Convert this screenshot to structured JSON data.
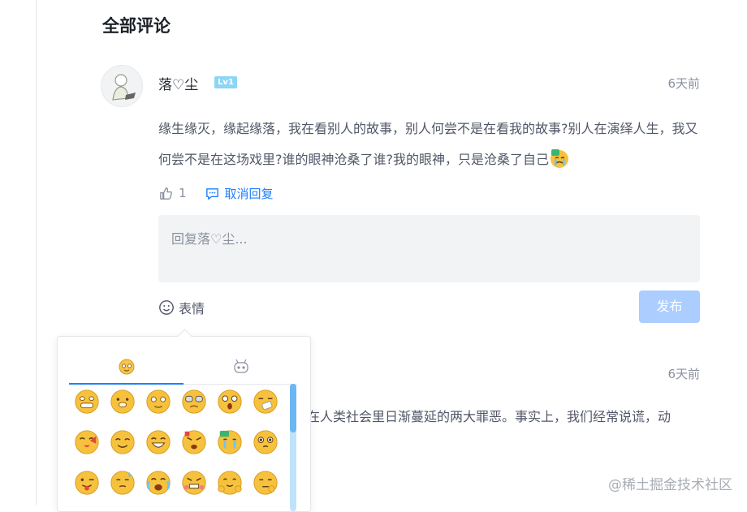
{
  "section": {
    "title": "全部评论"
  },
  "comment1": {
    "username": "落♡尘",
    "level": "Lv1",
    "time": "6天前",
    "text": "缘生缘灭，缘起缘落，我在看别人的故事，别人何尝不是在看我的故事?别人在演绎人生，我又何尝不是在这场戏里?谁的眼神沧桑了谁?我的眼神，只是沧桑了自己",
    "likes": "1",
    "cancel_reply_label": "取消回复",
    "reply_placeholder": "回复落♡尘...",
    "emoji_label": "表情",
    "publish_label": "发布"
  },
  "comment2": {
    "time": "6天前",
    "text_fragment": "在人类社会里日渐蔓延的两大罪恶。事实上，我们经常说谎，动"
  },
  "emoji_panel": {
    "tabs": [
      "smiley-tab-icon",
      "robot-tab-icon"
    ],
    "active_tab": 0,
    "emojis": [
      "grin-icon",
      "doge-icon",
      "smile-icon",
      "glasses-icon",
      "shocked-icon",
      "sneeze-icon",
      "kiss-icon",
      "smirk-icon",
      "laugh-icon",
      "angry-icon",
      "cry-icon",
      "blush-icon",
      "tongue-icon",
      "sweat-icon",
      "tears-icon",
      "rage-icon",
      "hug-icon",
      "think-icon"
    ],
    "accent_color": "#1e80ff"
  },
  "watermark": "@稀土掘金技术社区"
}
